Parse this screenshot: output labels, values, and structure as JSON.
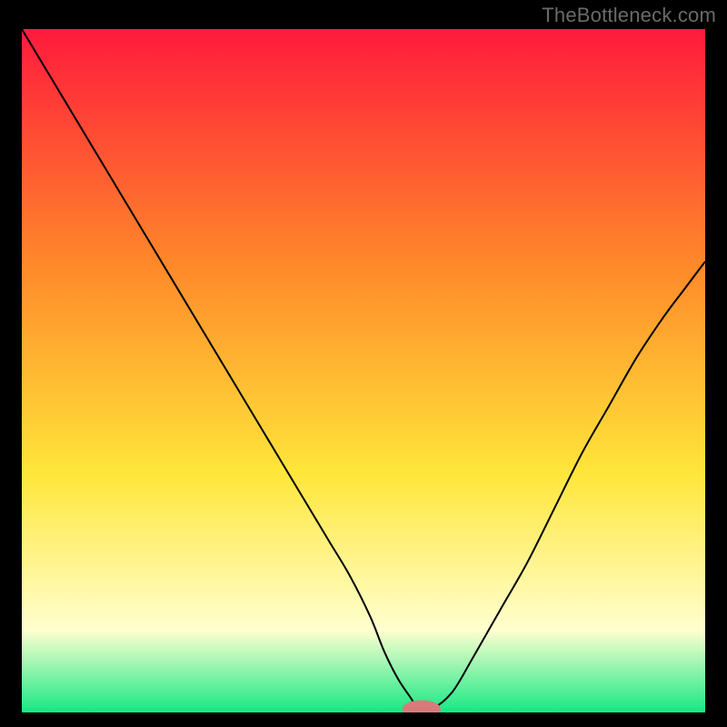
{
  "attribution": "TheBottleneck.com",
  "colors": {
    "curve": "#000000",
    "marker_fill": "#d87a7a",
    "marker_stroke": "#d87a7a",
    "frame": "#000000",
    "grad_red": "#ff1a3c",
    "grad_orange": "#ff8a2a",
    "grad_yellow": "#ffe63a",
    "grad_pale": "#ffffd0",
    "grad_green": "#16e884"
  },
  "chart_data": {
    "type": "line",
    "title": "",
    "xlabel": "",
    "ylabel": "",
    "xlim": [
      0,
      100
    ],
    "ylim": [
      0,
      100
    ],
    "x": [
      0,
      3,
      6,
      9,
      12,
      15,
      18,
      21,
      24,
      27,
      30,
      33,
      36,
      39,
      42,
      45,
      48,
      51,
      53,
      55,
      57,
      58,
      60,
      63,
      66,
      70,
      74,
      78,
      82,
      86,
      90,
      94,
      97,
      100
    ],
    "values": [
      100,
      95,
      90,
      85,
      80,
      75,
      70,
      65,
      60,
      55,
      50,
      45,
      40,
      35,
      30,
      25,
      20,
      14,
      9,
      5,
      2,
      0.5,
      0.5,
      3,
      8,
      15,
      22,
      30,
      38,
      45,
      52,
      58,
      62,
      66
    ],
    "marker": {
      "x": 58.5,
      "y": 0.5,
      "rx": 2.8,
      "ry": 1.3
    }
  }
}
